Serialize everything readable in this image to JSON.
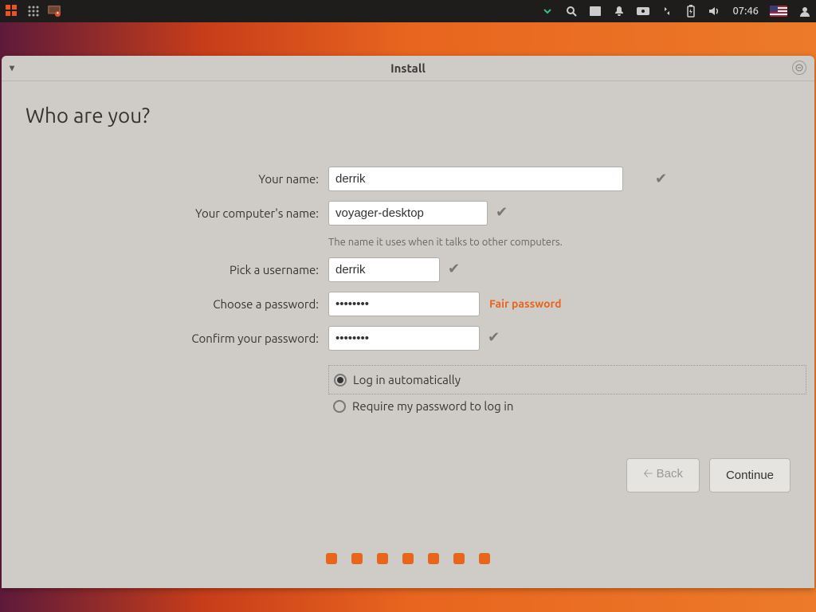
{
  "panel": {
    "clock": "07:46"
  },
  "window": {
    "title": "Install"
  },
  "page": {
    "heading": "Who are you?"
  },
  "form": {
    "your_name_label": "Your name:",
    "your_name_value": "derrik",
    "computer_name_label": "Your computer's name:",
    "computer_name_value": "voyager-desktop",
    "computer_name_hint": "The name it uses when it talks to other computers.",
    "username_label": "Pick a username:",
    "username_value": "derrik",
    "password_label": "Choose a password:",
    "password_value": "••••••••",
    "password_strength": "Fair password",
    "confirm_label": "Confirm your password:",
    "confirm_value": "••••••••",
    "login_auto_label": "Log in automatically",
    "login_require_label": "Require my password to log in"
  },
  "buttons": {
    "back": "Back",
    "continue": "Continue"
  }
}
